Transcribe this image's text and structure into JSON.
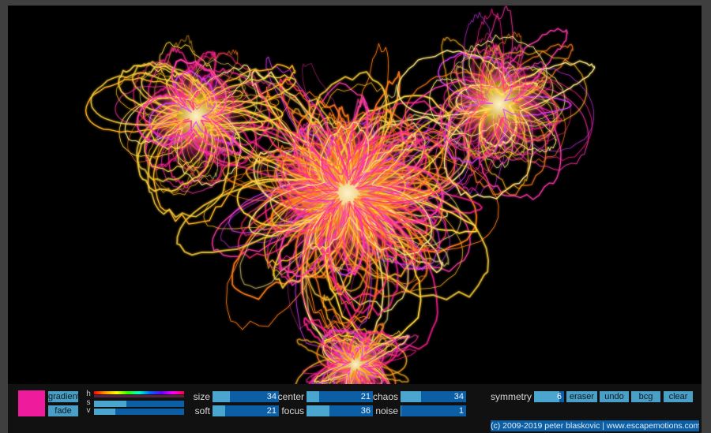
{
  "app": {
    "canvas_background": "#000000",
    "ui_accent": "#4aa6cf",
    "ui_track": "#0d5fa5",
    "frame_color": "#3f3f3f",
    "toolbar_color": "#111111"
  },
  "color": {
    "current": "#ee1c9c",
    "gradient_label": "gradient",
    "fade_label": "fade",
    "h_label": "h",
    "s_label": "s",
    "v_label": "v",
    "s_level": 0.36,
    "v_level": 0.24
  },
  "params": {
    "size": {
      "label": "size",
      "value": "34",
      "level": 0.26
    },
    "soft": {
      "label": "soft",
      "value": "21",
      "level": 0.19
    },
    "center": {
      "label": "center",
      "value": "21",
      "level": 0.19
    },
    "focus": {
      "label": "focus",
      "value": "36",
      "level": 0.34
    },
    "chaos": {
      "label": "chaos",
      "value": "34",
      "level": 0.31
    },
    "noise": {
      "label": "noise",
      "value": "1",
      "level": 0.01
    },
    "symmetry": {
      "label": "symmetry",
      "value": "6",
      "level": 0.85
    }
  },
  "actions": {
    "eraser": "eraser",
    "undo": "undo",
    "bcg": "bcg",
    "clear": "clear"
  },
  "footer": {
    "credit": "(c) 2009-2019 peter blaskovic | www.escapemotions.com"
  }
}
